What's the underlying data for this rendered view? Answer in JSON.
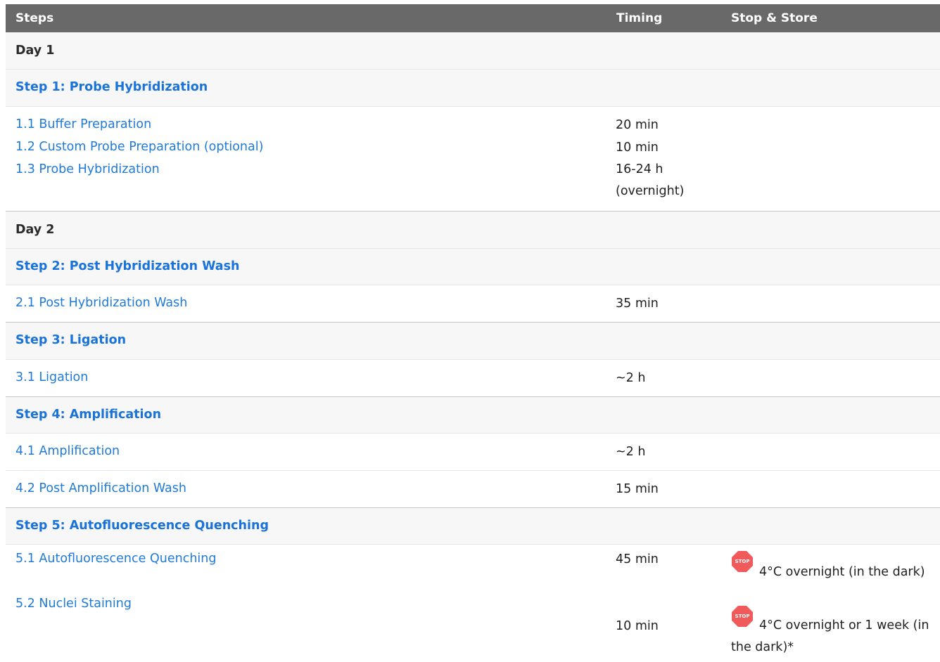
{
  "header": {
    "steps": "Steps",
    "timing": "Timing",
    "stop_store": "Stop & Store"
  },
  "day1": "Day 1",
  "step1": {
    "title": "Step 1: Probe Hybridization",
    "items": [
      "1.1 Buffer Preparation",
      "1.2 Custom Probe Preparation (optional)",
      "1.3 Probe Hybridization"
    ],
    "times": [
      "20 min",
      "10 min",
      "16-24 h",
      "(overnight)"
    ]
  },
  "day2": "Day 2",
  "step2": {
    "title": "Step 2: Post Hybridization Wash",
    "item": "2.1 Post Hybridization Wash",
    "time": "35 min"
  },
  "step3": {
    "title": "Step 3: Ligation",
    "item": "3.1 Ligation",
    "time": "~2 h"
  },
  "step4": {
    "title": "Step 4: Amplification",
    "item1": "4.1 Amplification",
    "time1": "~2 h",
    "item2": "4.2 Post Amplification Wash",
    "time2": "15 min"
  },
  "step5": {
    "title": "Step 5: Autofluorescence Quenching",
    "item1": "5.1 Autofluorescence Quenching",
    "time1": "45 min",
    "item2": "5.2 Nuclei Staining",
    "time2": "10 min",
    "store1": "4°C overnight (in the dark)",
    "store2": "4°C overnight or 1 week (in the dark)*"
  },
  "stop_label": "STOP",
  "colors": {
    "header_bg": "#696969",
    "link": "#1f7ad8",
    "stop": "#f05a5a"
  }
}
